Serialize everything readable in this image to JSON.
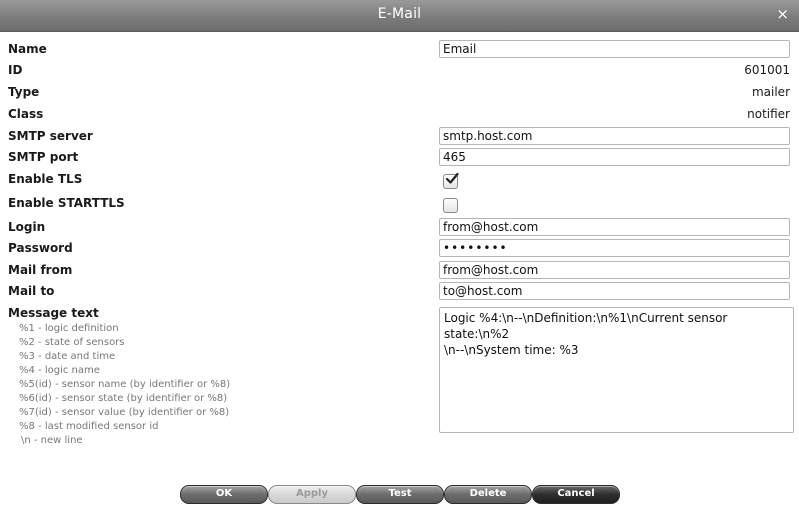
{
  "dialog": {
    "title": "E-Mail",
    "close_glyph": "×"
  },
  "fields": {
    "name": {
      "label": "Name",
      "value": "Email"
    },
    "id": {
      "label": "ID",
      "value": "601001"
    },
    "type": {
      "label": "Type",
      "value": "mailer"
    },
    "class": {
      "label": "Class",
      "value": "notifier"
    },
    "smtp_server": {
      "label": "SMTP server",
      "value": "smtp.host.com"
    },
    "smtp_port": {
      "label": "SMTP port",
      "value": "465"
    },
    "enable_tls": {
      "label": "Enable TLS",
      "checked": true
    },
    "enable_starttls": {
      "label": "Enable STARTTLS",
      "checked": false
    },
    "login": {
      "label": "Login",
      "value": "from@host.com"
    },
    "password": {
      "label": "Password",
      "value": "••••••••"
    },
    "mail_from": {
      "label": "Mail from",
      "value": "from@host.com"
    },
    "mail_to": {
      "label": "Mail to",
      "value": "to@host.com"
    },
    "message_text": {
      "label": "Message text",
      "value": "Logic %4:\\n--\\nDefinition:\\n%1\\nCurrent sensor state:\\n%2\n\\n--\\nSystem time: %3"
    }
  },
  "help": [
    "%1 - logic definition",
    "%2 - state of sensors",
    "%3 - date and time",
    "%4 - logic name",
    "%5(id) - sensor name (by identifier or %8)",
    "%6(id) - sensor state (by identifier or %8)",
    "%7(id) - sensor value (by identifier or %8)",
    "%8 - last modified sensor id",
    "\\n - new line"
  ],
  "buttons": {
    "ok": "OK",
    "apply": "Apply",
    "test": "Test",
    "delete": "Delete",
    "cancel": "Cancel"
  },
  "colors": {
    "titlebar": "#7c7c7c",
    "button_dark": "#2e2e2e",
    "help_text": "#777777"
  }
}
